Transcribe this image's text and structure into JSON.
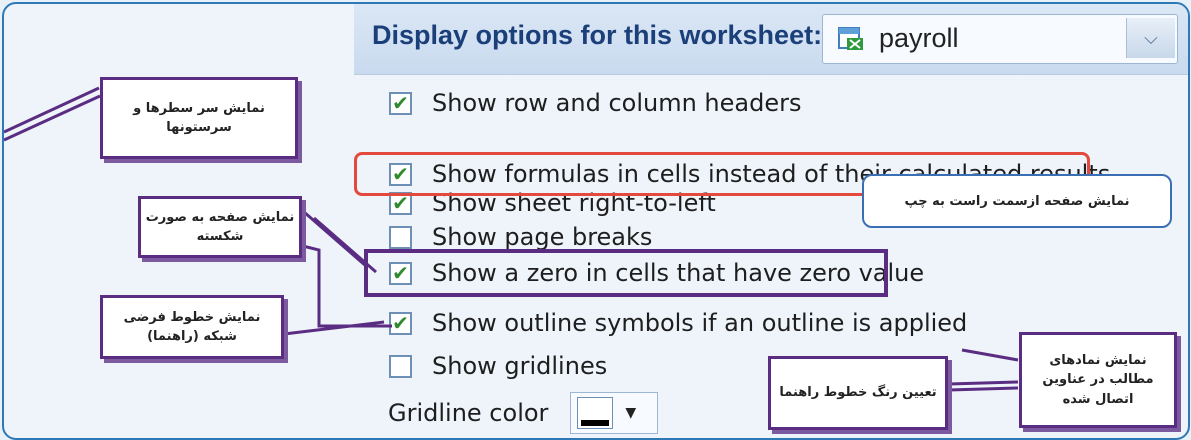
{
  "header": {
    "title": "Display options for this worksheet:",
    "sheet_name": "payroll",
    "sheet_icon": "excel-sheet-icon",
    "dropdown_icon": "chevron-down-icon"
  },
  "options": [
    {
      "label": "Show row and column headers",
      "checked": true
    },
    {
      "label": "Show formulas in cells instead of their calculated results",
      "checked": true
    },
    {
      "label": "Show sheet right-to-left",
      "checked": true
    },
    {
      "label": "Show page breaks",
      "checked": false
    },
    {
      "label": "Show a zero in cells that have zero value",
      "checked": true
    },
    {
      "label": "Show outline symbols if an outline is applied",
      "checked": true
    },
    {
      "label": "Show gridlines",
      "checked": false
    }
  ],
  "gridline": {
    "label": "Gridline color",
    "button_icon": "fill-color-icon"
  },
  "callouts": {
    "headers": "نمایش سر سطرها و سرستونها",
    "rtl": "نمایش صفحه ازسمت راست به چپ",
    "page_breaks": "نمایش صفحه به صورت شکسته",
    "gridlines": "نمایش خطوط فرضی شبکه (راهنما)",
    "outline": "نمایش نمادهای مطالب در عناوین اتصال شده",
    "gridline_color": "تعیین رنگ خطوط راهنما"
  },
  "colors": {
    "accent": "#2f78b6",
    "highlight_red": "#e34a3d",
    "highlight_purple": "#5a2d82",
    "check_green": "#2f8a2f"
  }
}
